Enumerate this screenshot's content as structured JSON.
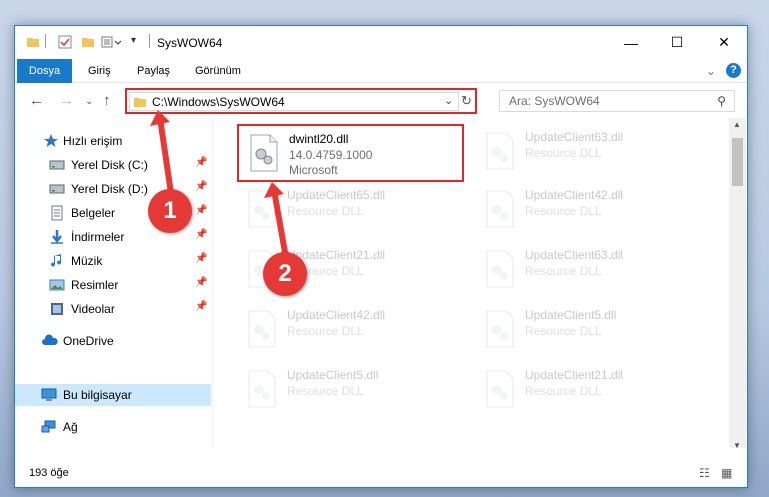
{
  "window": {
    "title": "SysWOW64",
    "minimize_glyph": "—",
    "maximize_glyph": "☐",
    "close_glyph": "✕"
  },
  "ribbon": {
    "tabs": [
      "Dosya",
      "Giriş",
      "Paylaş",
      "Görünüm"
    ],
    "active_tab": "Dosya"
  },
  "nav": {
    "address": "C:\\Windows\\SysWOW64",
    "search_placeholder": "Ara: SysWOW64"
  },
  "sidebar": {
    "items": [
      {
        "label": "Hızlı erişim",
        "icon": "star-icon"
      },
      {
        "label": "Yerel Disk (C:)",
        "icon": "drive-icon"
      },
      {
        "label": "Yerel Disk (D:)",
        "icon": "drive-icon"
      },
      {
        "label": "Belgeler",
        "icon": "documents-icon"
      },
      {
        "label": "İndirmeler",
        "icon": "download-icon"
      },
      {
        "label": "Müzik",
        "icon": "music-icon"
      },
      {
        "label": "Resimler",
        "icon": "pictures-icon"
      },
      {
        "label": "Videolar",
        "icon": "videos-icon"
      },
      {
        "label": "OneDrive",
        "icon": "cloud-icon"
      },
      {
        "label": "Bu bilgisayar",
        "icon": "computer-icon"
      },
      {
        "label": "Ağ",
        "icon": "network-icon"
      }
    ]
  },
  "files": [
    {
      "name": "dwintl20.dll",
      "version": "14.0.4759.1000",
      "company": "Microsoft",
      "highlighted": true
    },
    {
      "name": "UpdateClient63.dll",
      "type": "Resource DLL"
    },
    {
      "name": "UpdateClient65.dll",
      "type": "Resource DLL"
    },
    {
      "name": "UpdateClient42.dll",
      "type": "Resource DLL"
    },
    {
      "name": "UpdateClient21.dll",
      "type": "Resource DLL"
    },
    {
      "name": "UpdateClient63.dll",
      "type": "Resource DLL"
    },
    {
      "name": "UpdateClient42.dll",
      "type": "Resource DLL"
    },
    {
      "name": "UpdateClient5.dll",
      "type": "Resource DLL"
    },
    {
      "name": "UpdateClient5.dll",
      "type": "Resource DLL"
    },
    {
      "name": "UpdateClient21.dll",
      "type": "Resource DLL"
    }
  ],
  "status": {
    "item_count": "193 öğe"
  },
  "markers": [
    "1",
    "2"
  ],
  "colors": {
    "accent": "#1979ca",
    "highlight_border": "#e0252b",
    "marker": "#e53935"
  }
}
